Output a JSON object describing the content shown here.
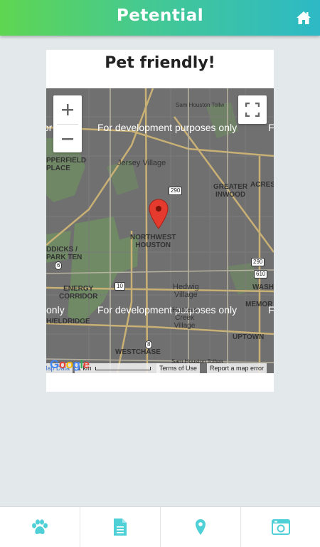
{
  "header": {
    "brand": "Petential",
    "home_icon": "home-icon",
    "gradient": [
      "#5fd651",
      "#2db9c6"
    ]
  },
  "card": {
    "title": "Pet friendly!"
  },
  "map": {
    "dev_watermark": "For development purposes only",
    "zoom_in": "+",
    "zoom_out": "−",
    "places": {
      "jersey_village": "Jersey Village",
      "northwest_houston": "NORTHWEST\nHOUSTON",
      "hedwig_village": "Hedwig\nVillage",
      "hunters_creek": "Hunters\nCreek\nVillage",
      "greater_inwood": "GREATER\nINWOOD",
      "acres": "ACRES",
      "wash": "WASH",
      "memor": "MEMOR",
      "uptown": "UPTOWN",
      "westchase": "WESTCHASE",
      "energy_corridor": "ENERGY\nCORRIDOR",
      "copperfield": "PPERFIELD\nPLACE",
      "addicks": "DDICKS /\nPARK TEN",
      "eldridge": "H/ELDRIDGE",
      "sam_houston_top": "Sam Houston Tollw",
      "sam_houston_bottom": "Sam Houston Tollwa"
    },
    "shields": [
      "290",
      "290",
      "10",
      "610",
      "6",
      "8",
      "290"
    ],
    "attribution": {
      "map_data": "Map Data",
      "scale": "1 km",
      "terms": "Terms of Use",
      "report": "Report a map error",
      "google": "Google"
    }
  },
  "tabs": [
    {
      "name": "paw-icon"
    },
    {
      "name": "document-icon"
    },
    {
      "name": "location-pin-icon"
    },
    {
      "name": "photo-icon"
    }
  ]
}
